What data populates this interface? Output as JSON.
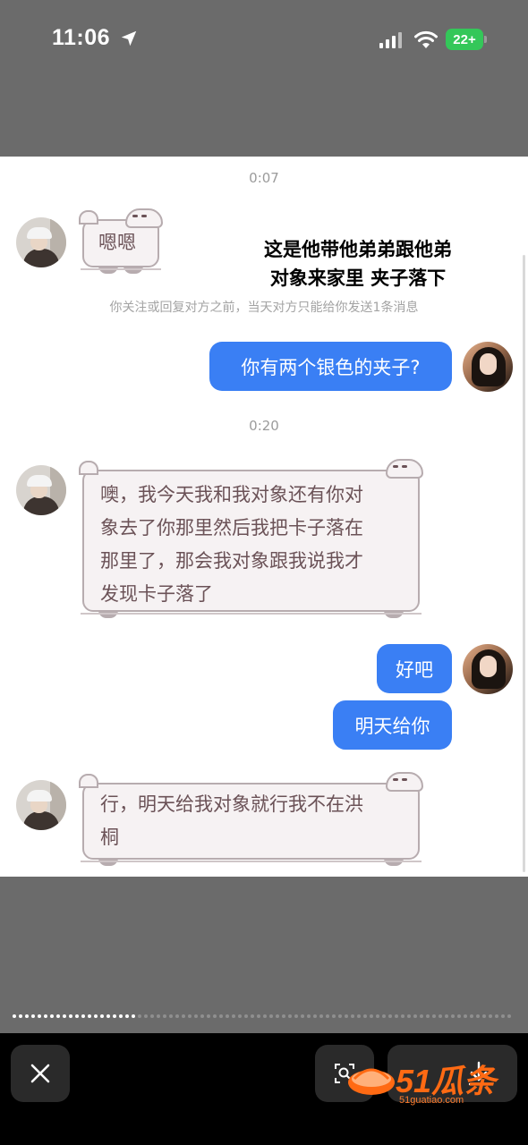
{
  "status_bar": {
    "time": "11:06",
    "battery": "22+"
  },
  "chat": {
    "overlay_caption_line1": "这是他带他弟弟跟他弟",
    "overlay_caption_line2": "对象来家里 夹子落下",
    "notice": "你关注或回复对方之前，当天对方只能给你发送1条消息",
    "messages": [
      {
        "type": "timestamp",
        "text": "0:07"
      },
      {
        "type": "received",
        "text": "嗯嗯"
      },
      {
        "type": "sent",
        "text": "你有两个银色的夹子?"
      },
      {
        "type": "timestamp",
        "text": "0:20"
      },
      {
        "type": "received",
        "lines": [
          "噢，我今天我和我对象还有你对",
          "象去了你那里然后我把卡子落在",
          "那里了，那会我对象跟我说我才",
          "发现卡子落了"
        ]
      },
      {
        "type": "sent",
        "text": "好吧"
      },
      {
        "type": "sent",
        "text": "明天给你"
      },
      {
        "type": "received",
        "lines": [
          "行，明天给我对象就行我不在洪",
          "桐"
        ]
      }
    ]
  },
  "toolbar": {
    "close_icon": "close-icon",
    "lens_icon": "image-search-icon",
    "download_icon": "download-icon"
  },
  "watermark": {
    "brand": "51瓜条",
    "url": "51guatiao.com"
  },
  "colors": {
    "bubble_blue": "#3a7ff4",
    "bubble_cute_bg": "#f6f2f3",
    "bubble_cute_text": "#6b5257"
  }
}
